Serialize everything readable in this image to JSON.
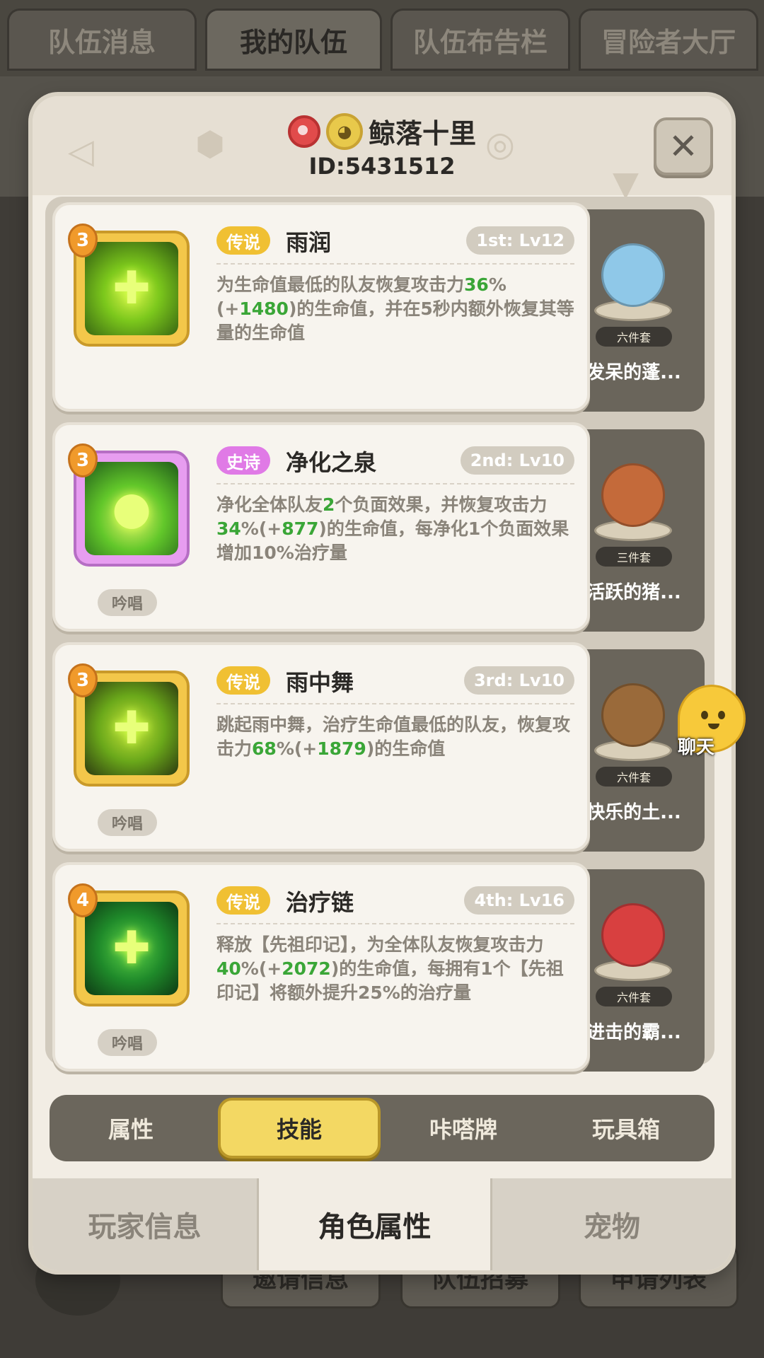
{
  "background": {
    "tabs": [
      "队伍消息",
      "我的队伍",
      "队伍布告栏",
      "冒险者大厅"
    ],
    "active_tab_index": 1,
    "bottom_buttons": [
      "邀请信息",
      "队伍招募",
      "申请列表"
    ]
  },
  "dialog": {
    "player_name": "鲸落十里",
    "player_id": "ID:5431512",
    "close_symbol": "✕",
    "skills": [
      {
        "rarity": "传说",
        "rarity_type": "legend",
        "name": "雨润",
        "rank": "1st: Lv12",
        "level_badge": "3",
        "icon": "heal-cross-icon",
        "desc_parts": [
          {
            "t": "为生命值最低的队友恢复攻击力"
          },
          {
            "t": "36",
            "g": true
          },
          {
            "t": "%(+"
          },
          {
            "t": "1480",
            "g": true
          },
          {
            "t": ")的生命值，并在5秒内额外恢复其等量的生命值"
          }
        ],
        "chant": ""
      },
      {
        "rarity": "史诗",
        "rarity_type": "epic",
        "name": "净化之泉",
        "rank": "2nd: Lv10",
        "level_badge": "3",
        "icon": "water-drop-icon",
        "desc_parts": [
          {
            "t": "净化全体队友"
          },
          {
            "t": "2",
            "g": true
          },
          {
            "t": "个负面效果，并恢复攻击力"
          },
          {
            "t": "34",
            "g": true
          },
          {
            "t": "%(+"
          },
          {
            "t": "877",
            "g": true
          },
          {
            "t": ")的生命值，每净化1个负面效果增加10%治疗量"
          }
        ],
        "chant": "吟唱"
      },
      {
        "rarity": "传说",
        "rarity_type": "legend",
        "name": "雨中舞",
        "rank": "3rd: Lv10",
        "level_badge": "3",
        "icon": "dance-heal-icon",
        "desc_parts": [
          {
            "t": "跳起雨中舞，治疗生命值最低的队友，恢复攻击力"
          },
          {
            "t": "68",
            "g": true
          },
          {
            "t": "%(+"
          },
          {
            "t": "1879",
            "g": true
          },
          {
            "t": ")的生命值"
          }
        ],
        "chant": "吟唱"
      },
      {
        "rarity": "传说",
        "rarity_type": "legend",
        "name": "治疗链",
        "rank": "4th: Lv16",
        "level_badge": "4",
        "icon": "heal-chain-icon",
        "desc_parts": [
          {
            "t": "释放【先祖印记】，为全体队友恢复攻击力"
          },
          {
            "t": "40",
            "g": true
          },
          {
            "t": "%(+"
          },
          {
            "t": "2072",
            "g": true
          },
          {
            "t": ")的生命值，每拥有1个【先祖印记】将额外提升25%的治疗量"
          }
        ],
        "chant": "吟唱"
      }
    ],
    "pets": [
      {
        "name": "发呆的蓬...",
        "badge": "六件套",
        "color": "#8fc8e8"
      },
      {
        "name": "活跃的猪...",
        "badge": "三件套",
        "color": "#c46a3a"
      },
      {
        "name": "快乐的土...",
        "badge": "六件套",
        "color": "#9a6a3a"
      },
      {
        "name": "进击的霸...",
        "badge": "六件套",
        "color": "#d84040"
      }
    ],
    "sub_tabs": [
      "属性",
      "技能",
      "咔嗒牌",
      "玩具箱"
    ],
    "active_sub_tab": 1,
    "bottom_tabs": [
      "玩家信息",
      "角色属性",
      "宠物"
    ],
    "active_bottom_tab": 1
  },
  "chat": {
    "label": "聊天"
  }
}
